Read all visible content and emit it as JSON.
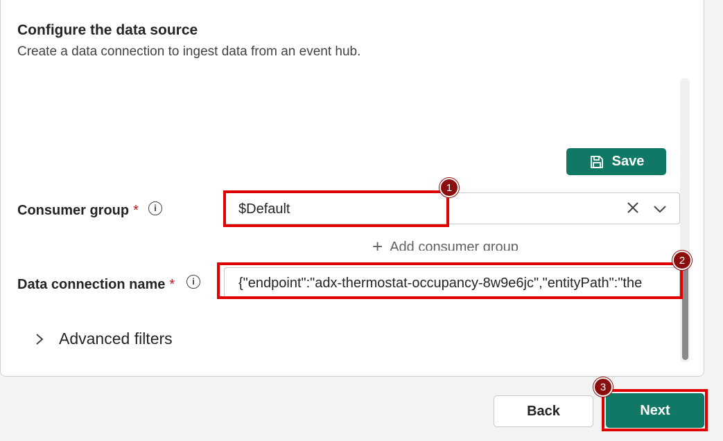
{
  "header": {
    "title": "Configure the data source",
    "subtitle": "Create a data connection to ingest data from an event hub."
  },
  "save_button": {
    "label": "Save",
    "icon": "save-icon"
  },
  "consumer_group": {
    "label": "Consumer group",
    "required_mark": "*",
    "info_icon": "info-icon",
    "value": "$Default",
    "add_label": "Add consumer group"
  },
  "data_connection": {
    "label": "Data connection name",
    "required_mark": "*",
    "info_icon": "info-icon",
    "value": "{\"endpoint\":\"adx-thermostat-occupancy-8w9e6jc\",\"entityPath\":\"the"
  },
  "advanced": {
    "label": "Advanced filters"
  },
  "footer": {
    "back_label": "Back",
    "next_label": "Next"
  },
  "annotations": {
    "marker_1": "1",
    "marker_2": "2",
    "marker_3": "3"
  },
  "colors": {
    "accent": "#117865",
    "highlight": "#e00000",
    "marker": "#8b0d0d",
    "required": "#c50f1f"
  }
}
